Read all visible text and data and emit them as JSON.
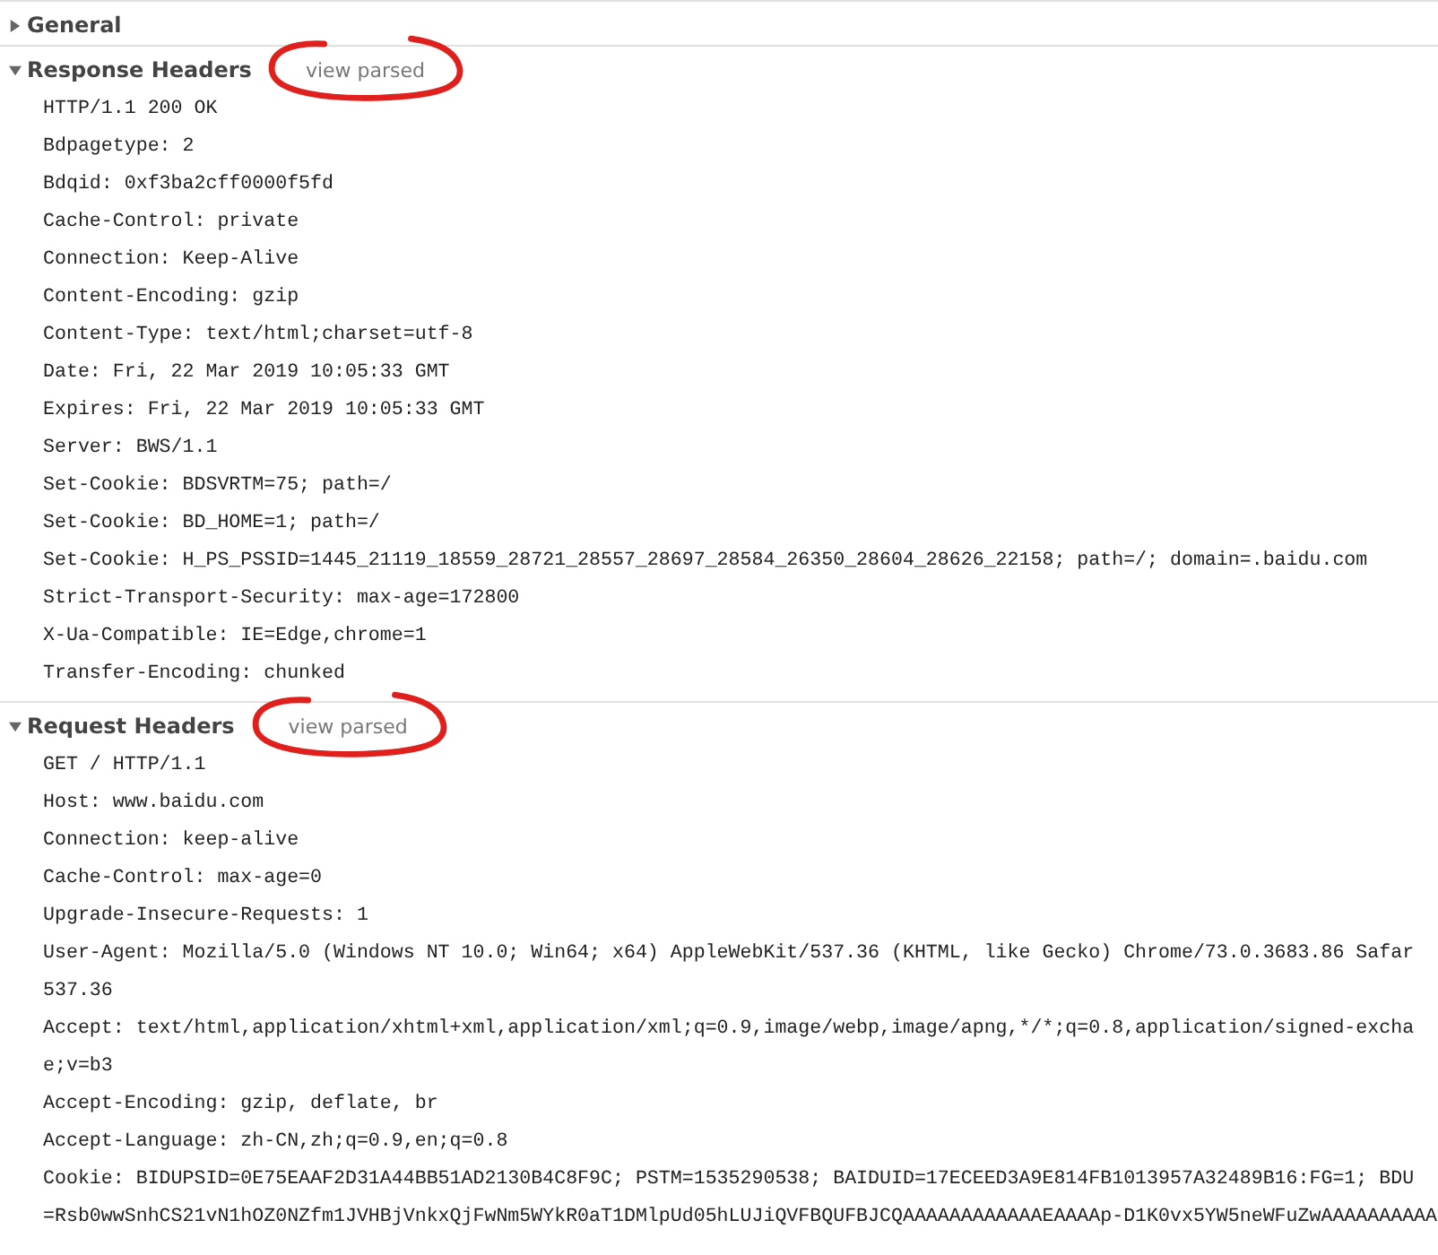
{
  "sections": [
    {
      "title": "General",
      "expanded": false
    },
    {
      "title": "Response Headers",
      "expanded": true,
      "link": {
        "label": "view parsed",
        "annotated": true
      },
      "lines": [
        "HTTP/1.1 200 OK",
        "Bdpagetype: 2",
        "Bdqid: 0xf3ba2cff0000f5fd",
        "Cache-Control: private",
        "Connection: Keep-Alive",
        "Content-Encoding: gzip",
        "Content-Type: text/html;charset=utf-8",
        "Date: Fri, 22 Mar 2019 10:05:33 GMT",
        "Expires: Fri, 22 Mar 2019 10:05:33 GMT",
        "Server: BWS/1.1",
        "Set-Cookie: BDSVRTM=75; path=/",
        "Set-Cookie: BD_HOME=1; path=/",
        "Set-Cookie: H_PS_PSSID=1445_21119_18559_28721_28557_28697_28584_26350_28604_28626_22158; path=/; domain=.baidu.com",
        "Strict-Transport-Security: max-age=172800",
        "X-Ua-Compatible: IE=Edge,chrome=1",
        "Transfer-Encoding: chunked"
      ]
    },
    {
      "title": "Request Headers",
      "expanded": true,
      "link": {
        "label": "view parsed",
        "annotated": true
      },
      "lines": [
        "GET / HTTP/1.1",
        "Host: www.baidu.com",
        "Connection: keep-alive",
        "Cache-Control: max-age=0",
        "Upgrade-Insecure-Requests: 1",
        "User-Agent: Mozilla/5.0 (Windows NT 10.0; Win64; x64) AppleWebKit/537.36 (KHTML, like Gecko) Chrome/73.0.3683.86 Safar",
        "537.36",
        "Accept: text/html,application/xhtml+xml,application/xml;q=0.9,image/webp,image/apng,*/*;q=0.8,application/signed-excha",
        "e;v=b3",
        "Accept-Encoding: gzip, deflate, br",
        "Accept-Language: zh-CN,zh;q=0.9,en;q=0.8",
        "Cookie: BIDUPSID=0E75EAAF2D31A44BB51AD2130B4C8F9C; PSTM=1535290538; BAIDUID=17ECEED3A9E814FB1013957A32489B16:FG=1; BDU",
        "=Rsb0wwSnhCS21vN1hOZ0NZfm1JVHBjVnkxQjFwNm5WYkR0aT1DMlpUd05hLUJiQVFBQUFBJCQAAAAAAAAAAAAEAAAAp-D1K0vx5YW5neWFuZwAAAAAAAAAA"
      ]
    }
  ]
}
